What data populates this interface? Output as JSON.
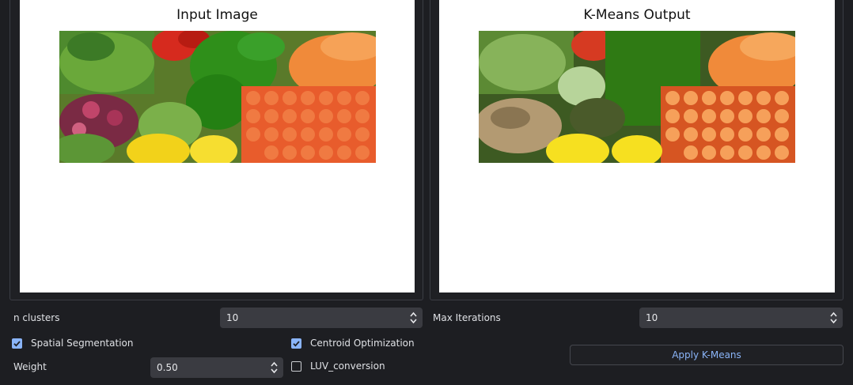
{
  "input_view": {
    "title": "Input Image"
  },
  "output_view": {
    "title": "K-Means Output"
  },
  "controls": {
    "n_clusters": {
      "label": "n clusters",
      "value": "10"
    },
    "max_iterations": {
      "label": "Max Iterations",
      "value": "10"
    },
    "spatial_segmentation": {
      "label": "Spatial Segmentation",
      "checked": true
    },
    "centroid_optimization": {
      "label": "Centroid Optimization",
      "checked": true
    },
    "weight": {
      "label": "Weight",
      "value": "0.50"
    },
    "luv_conversion": {
      "label": "LUV_conversion",
      "checked": false
    },
    "apply_button": {
      "label": "Apply K-Means"
    }
  },
  "colors": {
    "accent": "#8ab4f8",
    "background": "#1d1e22",
    "spinbox": "#3a3b41"
  }
}
